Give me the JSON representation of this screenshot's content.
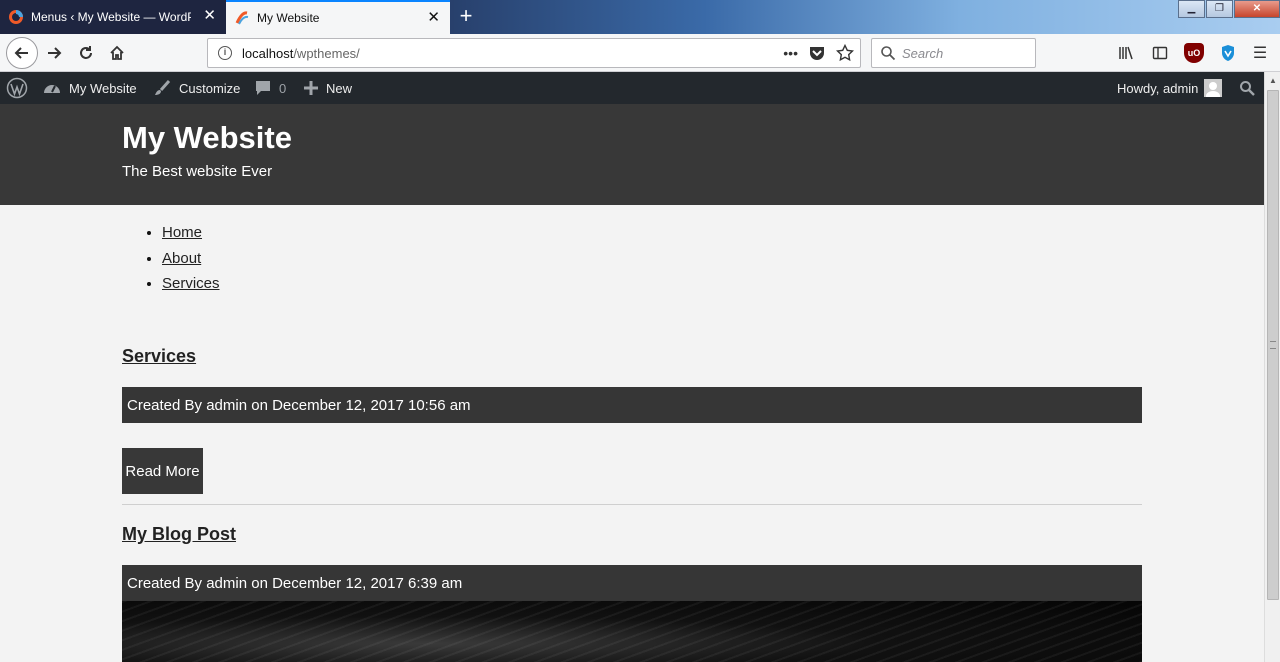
{
  "browser": {
    "tabs": [
      {
        "title": "Menus ‹ My Website — WordPress",
        "active": false
      },
      {
        "title": "My Website",
        "active": true
      }
    ],
    "new_tab_label": "+",
    "url_host": "localhost",
    "url_path": "/wpthemes/",
    "url_actions": [
      "•••"
    ],
    "search_placeholder": "Search",
    "menu_glyph": "☰"
  },
  "adminbar": {
    "site_name": "My Website",
    "customize": "Customize",
    "comments_count": "0",
    "new_label": "New",
    "howdy": "Howdy, admin"
  },
  "site": {
    "title": "My Website",
    "tagline": "The Best website Ever"
  },
  "nav": {
    "items": [
      {
        "label": "Home"
      },
      {
        "label": "About"
      },
      {
        "label": "Services"
      }
    ]
  },
  "posts": [
    {
      "title": "Services",
      "meta": "Created By admin on December 12, 2017 10:56 am",
      "read_more": "Read More"
    },
    {
      "title": "My Blog Post",
      "meta": "Created By admin on December 12, 2017 6:39 am"
    }
  ],
  "colors": {
    "header_bg": "#383838",
    "adminbar_bg": "#23282d",
    "page_bg": "#f3f3f3"
  }
}
